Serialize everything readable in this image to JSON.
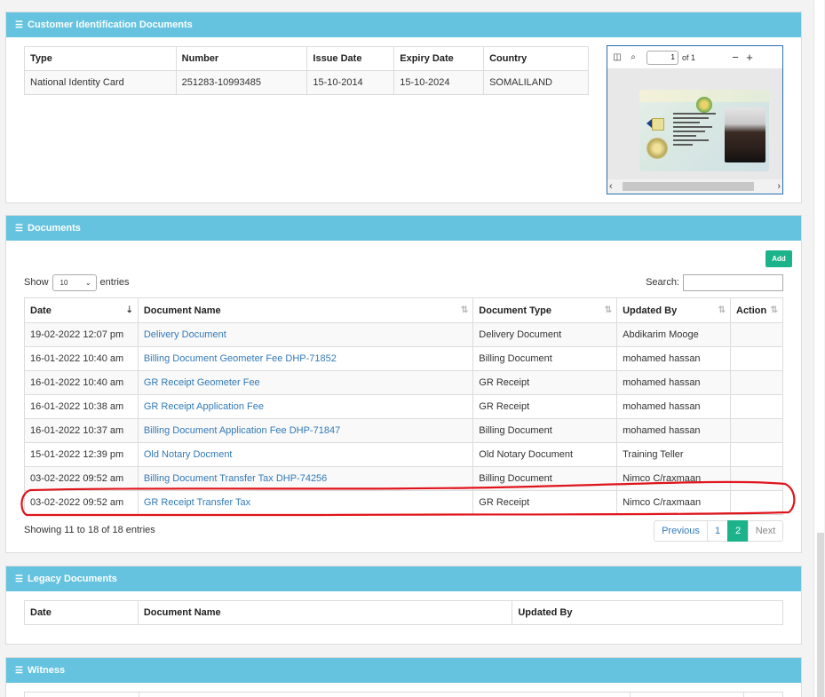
{
  "id_docs": {
    "title": "Customer Identification Documents",
    "columns": [
      "Type",
      "Number",
      "Issue Date",
      "Expiry Date",
      "Country"
    ],
    "rows": [
      [
        "National Identity Card",
        "251283-10993485",
        "15-10-2014",
        "15-10-2024",
        "SOMALILAND"
      ]
    ],
    "viewer": {
      "page_value": "1",
      "page_of": "of 1",
      "zoom_out": "−",
      "zoom_in": "+"
    }
  },
  "documents": {
    "title": "Documents",
    "add_label": "Add",
    "show_label": "Show",
    "entries_label": "entries",
    "page_length": "10",
    "search_label": "Search:",
    "columns": [
      "Date",
      "Document Name",
      "Document Type",
      "Updated By",
      "Action"
    ],
    "rows": [
      {
        "date": "19-02-2022 12:07 pm",
        "name": "Delivery Document",
        "type": "Delivery Document",
        "by": "Abdikarim Mooge"
      },
      {
        "date": "16-01-2022 10:40 am",
        "name": "Billing Document Geometer Fee DHP-71852",
        "type": "Billing Document",
        "by": "mohamed hassan"
      },
      {
        "date": "16-01-2022 10:40 am",
        "name": "GR Receipt Geometer Fee",
        "type": "GR Receipt",
        "by": "mohamed hassan"
      },
      {
        "date": "16-01-2022 10:38 am",
        "name": "GR Receipt Application Fee",
        "type": "GR Receipt",
        "by": "mohamed hassan"
      },
      {
        "date": "16-01-2022 10:37 am",
        "name": "Billing Document Application Fee DHP-71847",
        "type": "Billing Document",
        "by": "mohamed hassan"
      },
      {
        "date": "15-01-2022 12:39 pm",
        "name": "Old Notary Docment",
        "type": "Old Notary Document",
        "by": "Training Teller"
      },
      {
        "date": "03-02-2022 09:52 am",
        "name": "Billing Document Transfer Tax DHP-74256",
        "type": "Billing Document",
        "by": "Nimco C/raxmaan"
      },
      {
        "date": "03-02-2022 09:52 am",
        "name": "GR Receipt Transfer Tax",
        "type": "GR Receipt",
        "by": "Nimco C/raxmaan"
      }
    ],
    "info": "Showing 11 to 18 of 18 entries",
    "pager": {
      "previous": "Previous",
      "pages": [
        "1",
        "2"
      ],
      "current": "2",
      "next": "Next"
    },
    "annotation_color": "#e0141b"
  },
  "legacy": {
    "title": "Legacy Documents",
    "columns": [
      "Date",
      "Document Name",
      "Updated By"
    ]
  },
  "witness": {
    "title": "Witness"
  },
  "colors": {
    "panel_header": "#65c3df",
    "accent_green": "#1cb38b",
    "link": "#337ab7"
  }
}
